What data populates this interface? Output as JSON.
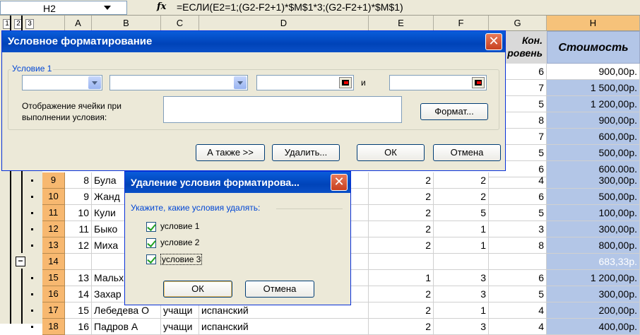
{
  "formula_bar": {
    "name_box": "H2",
    "fx_icon": "fx",
    "formula": "=ЕСЛИ(E2=1;(G2-F2+1)*$M$1*3;(G2-F2+1)*$M$1)"
  },
  "sheet": {
    "outline_levels": [
      "1",
      "2",
      "3"
    ],
    "columns": [
      "A",
      "B",
      "C",
      "D",
      "E",
      "F",
      "G",
      "H"
    ],
    "selected_column": "H",
    "header_g": "Кон.\nровень",
    "header_h": "Стоимость",
    "column_g_values_top": [
      "6",
      "7",
      "5",
      "8",
      "7",
      "5",
      "6"
    ],
    "column_h_values_top": [
      "900,00р.",
      "1 500,00р.",
      "1 200,00р.",
      "900,00р.",
      "600,00р.",
      "500,00р.",
      "600,00р."
    ],
    "rows": [
      {
        "row": "9",
        "a": "8",
        "b": "Була",
        "c": "",
        "d": "",
        "e": "2",
        "f": "2",
        "g": "4",
        "h": "300,00р."
      },
      {
        "row": "10",
        "a": "9",
        "b": "Жанд",
        "c": "",
        "d": "",
        "e": "2",
        "f": "2",
        "g": "6",
        "h": "500,00р."
      },
      {
        "row": "11",
        "a": "10",
        "b": "Кули",
        "c": "",
        "d": "",
        "e": "2",
        "f": "5",
        "g": "5",
        "h": "100,00р."
      },
      {
        "row": "12",
        "a": "11",
        "b": "Быко",
        "c": "",
        "d": "",
        "e": "2",
        "f": "1",
        "g": "3",
        "h": "300,00р."
      },
      {
        "row": "13",
        "a": "12",
        "b": "Миха",
        "c": "",
        "d": "",
        "e": "2",
        "f": "1",
        "g": "8",
        "h": "800,00р."
      },
      {
        "row": "14",
        "a": "",
        "b": "",
        "c": "",
        "d": "",
        "e": "",
        "f": "",
        "g": "",
        "h": "683,33р."
      },
      {
        "row": "15",
        "a": "13",
        "b": "Мальх",
        "c": "",
        "d": "",
        "e": "1",
        "f": "3",
        "g": "6",
        "h": "1 200,00р."
      },
      {
        "row": "16",
        "a": "14",
        "b": "Захар",
        "c": "",
        "d": "",
        "e": "2",
        "f": "3",
        "g": "5",
        "h": "300,00р."
      },
      {
        "row": "17",
        "a": "15",
        "b": "Лебедева О",
        "c": "учащи",
        "d": "испанский",
        "e": "2",
        "f": "1",
        "g": "4",
        "h": "200,00р."
      },
      {
        "row": "18",
        "a": "16",
        "b": "Падров А",
        "c": "учащи",
        "d": "испанский",
        "e": "2",
        "f": "3",
        "g": "4",
        "h": "400,00р."
      }
    ]
  },
  "cond_format_dialog": {
    "title": "Условное форматирование",
    "group_label": "Условие 1",
    "and_label": "и",
    "display_label": "Отображение ячейки при выполнении условия:",
    "format_button": "Формат...",
    "also_button": "А также >>",
    "delete_button": "Удалить...",
    "ok_button": "ОК",
    "cancel_button": "Отмена"
  },
  "delete_dialog": {
    "title": "Удаление условия форматирова...",
    "prompt": "Укажите, какие условия удалять:",
    "conditions": [
      {
        "label": "условие 1",
        "checked": true
      },
      {
        "label": "условие 2",
        "checked": true
      },
      {
        "label": "условие 3",
        "checked": true
      }
    ],
    "ok_button": "ОК",
    "cancel_button": "Отмена"
  },
  "colors": {
    "title_bar": "#0a5ddb",
    "selected_column": "#b3c6e7",
    "row_header": "#f7b870",
    "dialog_bg": "#ece9d8"
  }
}
